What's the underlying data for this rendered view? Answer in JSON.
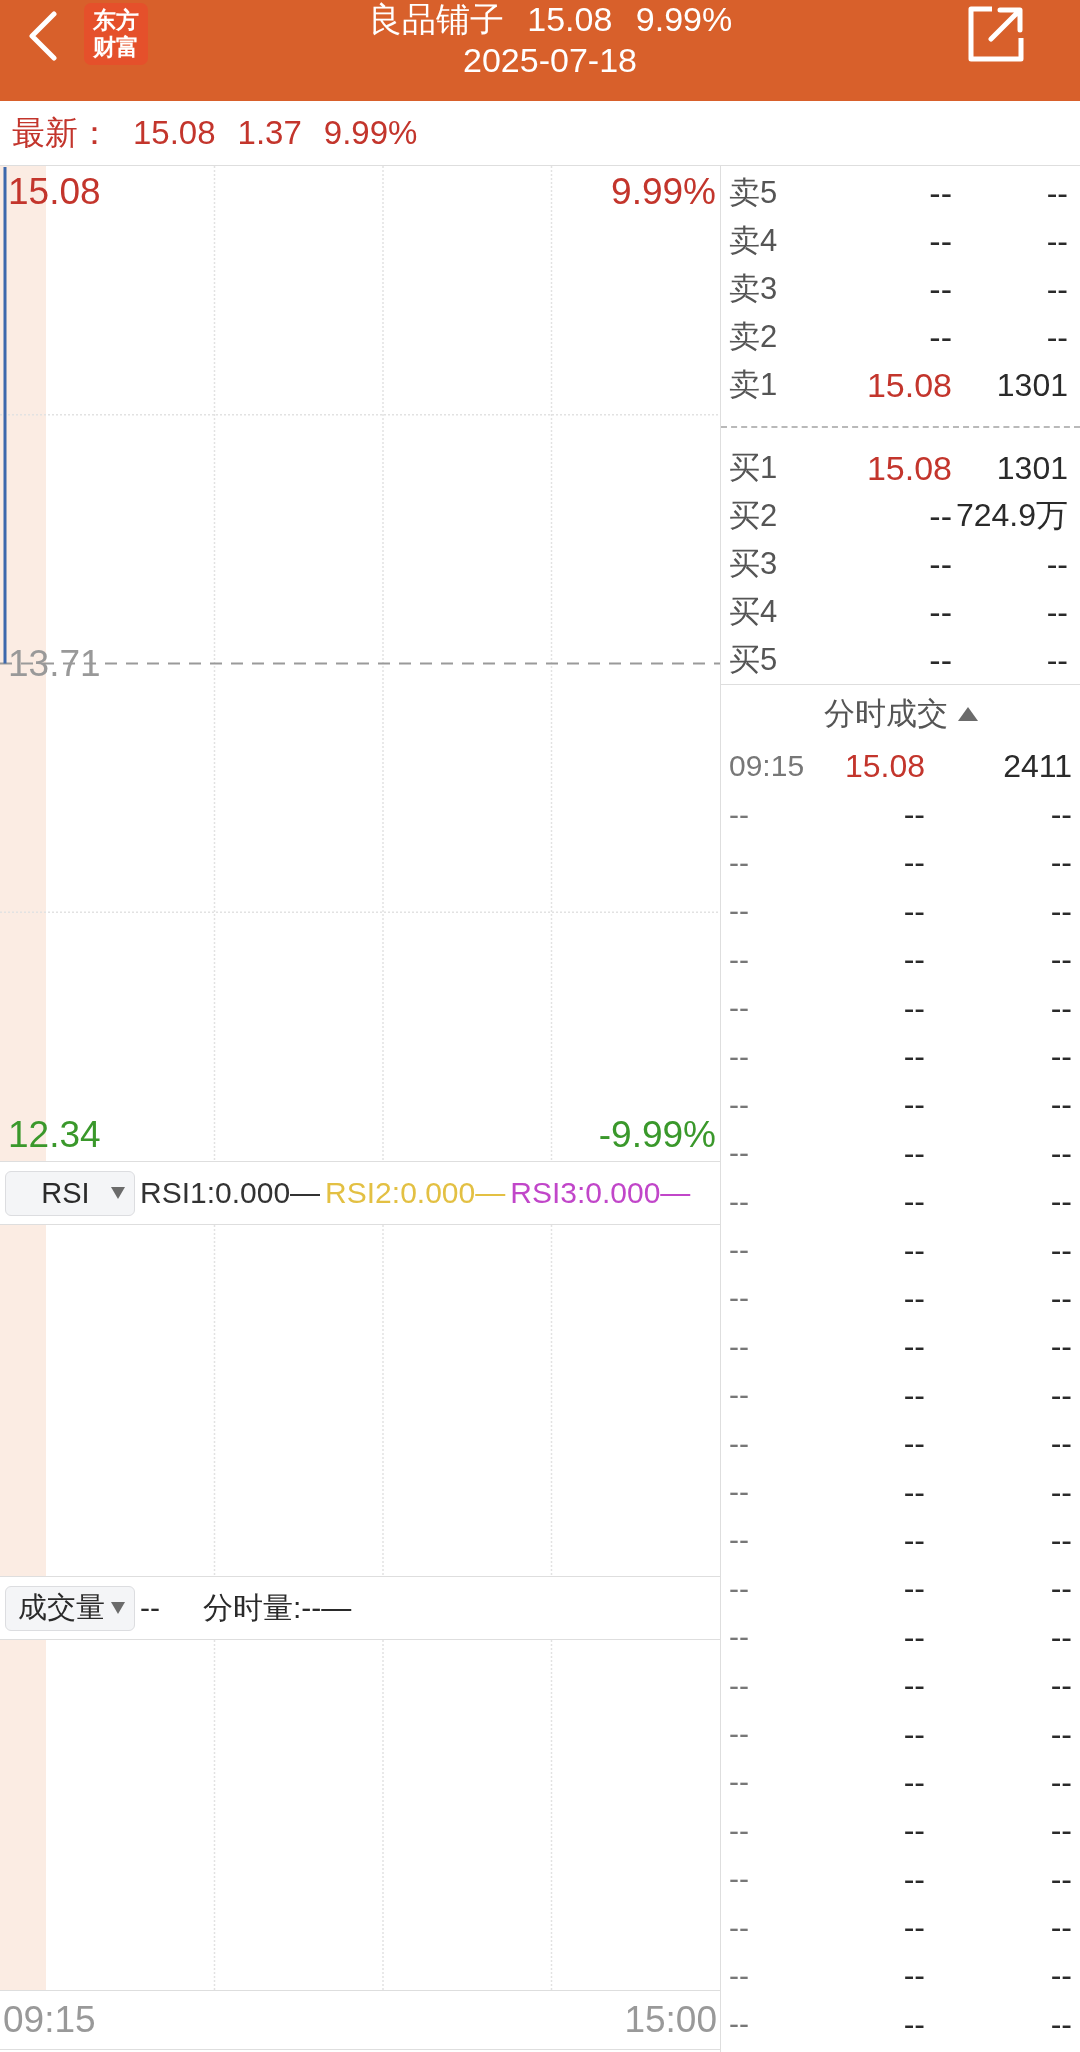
{
  "header": {
    "title": "良品铺子 15.08 9.99%",
    "date": "2025-07-18",
    "logo": [
      "东方",
      "财富"
    ]
  },
  "latest": {
    "label": "最新：",
    "price": "15.08",
    "change": "1.37",
    "pct": "9.99%"
  },
  "price_chart": {
    "left_labels": [
      {
        "text": "15.08",
        "color": "#c3352c"
      },
      {
        "text": "13.71",
        "color": "#999999"
      },
      {
        "text": "12.34",
        "color": "#3a982b"
      }
    ],
    "right_labels": [
      {
        "text": "9.99%",
        "color": "#c3352c"
      },
      {
        "text": "-9.99%",
        "color": "#3a982b"
      }
    ]
  },
  "rsi": {
    "selector": "RSI",
    "legend": [
      {
        "text": "RSI1:0.000—",
        "color": "#333333"
      },
      {
        "text": "RSI2:0.000—",
        "color": "#e3c043"
      },
      {
        "text": "RSI3:0.000—",
        "color": "#c146c9"
      }
    ]
  },
  "volume": {
    "selector": "成交量",
    "value": "--",
    "label": "分时量:--—"
  },
  "time_axis": [
    "09:15",
    "15:00"
  ],
  "order_book": {
    "asks": [
      {
        "label": "卖5",
        "price": "--",
        "volume": "--",
        "color": "#2a2a2a"
      },
      {
        "label": "卖4",
        "price": "--",
        "volume": "--",
        "color": "#2a2a2a"
      },
      {
        "label": "卖3",
        "price": "--",
        "volume": "--",
        "color": "#2a2a2a"
      },
      {
        "label": "卖2",
        "price": "--",
        "volume": "--",
        "color": "#2a2a2a"
      },
      {
        "label": "卖1",
        "price": "15.08",
        "volume": "1301",
        "color": "#c3352c"
      }
    ],
    "bids": [
      {
        "label": "买1",
        "price": "15.08",
        "volume": "1301",
        "color": "#c3352c"
      },
      {
        "label": "买2",
        "price": "--",
        "volume": "724.9万",
        "color": "#2a2a2a"
      },
      {
        "label": "买3",
        "price": "--",
        "volume": "--",
        "color": "#2a2a2a"
      },
      {
        "label": "买4",
        "price": "--",
        "volume": "--",
        "color": "#2a2a2a"
      },
      {
        "label": "买5",
        "price": "--",
        "volume": "--",
        "color": "#2a2a2a"
      }
    ]
  },
  "trades": {
    "title": "分时成交",
    "rows": [
      {
        "time": "09:15",
        "price": "15.08",
        "volume": "2411",
        "color": "#c3352c"
      },
      {
        "time": "--",
        "price": "--",
        "volume": "--",
        "color": "#2a2a2a"
      },
      {
        "time": "--",
        "price": "--",
        "volume": "--",
        "color": "#2a2a2a"
      },
      {
        "time": "--",
        "price": "--",
        "volume": "--",
        "color": "#2a2a2a"
      },
      {
        "time": "--",
        "price": "--",
        "volume": "--",
        "color": "#2a2a2a"
      },
      {
        "time": "--",
        "price": "--",
        "volume": "--",
        "color": "#2a2a2a"
      },
      {
        "time": "--",
        "price": "--",
        "volume": "--",
        "color": "#2a2a2a"
      },
      {
        "time": "--",
        "price": "--",
        "volume": "--",
        "color": "#2a2a2a"
      },
      {
        "time": "--",
        "price": "--",
        "volume": "--",
        "color": "#2a2a2a"
      },
      {
        "time": "--",
        "price": "--",
        "volume": "--",
        "color": "#2a2a2a"
      },
      {
        "time": "--",
        "price": "--",
        "volume": "--",
        "color": "#2a2a2a"
      },
      {
        "time": "--",
        "price": "--",
        "volume": "--",
        "color": "#2a2a2a"
      },
      {
        "time": "--",
        "price": "--",
        "volume": "--",
        "color": "#2a2a2a"
      },
      {
        "time": "--",
        "price": "--",
        "volume": "--",
        "color": "#2a2a2a"
      },
      {
        "time": "--",
        "price": "--",
        "volume": "--",
        "color": "#2a2a2a"
      },
      {
        "time": "--",
        "price": "--",
        "volume": "--",
        "color": "#2a2a2a"
      },
      {
        "time": "--",
        "price": "--",
        "volume": "--",
        "color": "#2a2a2a"
      },
      {
        "time": "--",
        "price": "--",
        "volume": "--",
        "color": "#2a2a2a"
      },
      {
        "time": "--",
        "price": "--",
        "volume": "--",
        "color": "#2a2a2a"
      },
      {
        "time": "--",
        "price": "--",
        "volume": "--",
        "color": "#2a2a2a"
      },
      {
        "time": "--",
        "price": "--",
        "volume": "--",
        "color": "#2a2a2a"
      },
      {
        "time": "--",
        "price": "--",
        "volume": "--",
        "color": "#2a2a2a"
      },
      {
        "time": "--",
        "price": "--",
        "volume": "--",
        "color": "#2a2a2a"
      },
      {
        "time": "--",
        "price": "--",
        "volume": "--",
        "color": "#2a2a2a"
      },
      {
        "time": "--",
        "price": "--",
        "volume": "--",
        "color": "#2a2a2a"
      },
      {
        "time": "--",
        "price": "--",
        "volume": "--",
        "color": "#2a2a2a"
      },
      {
        "time": "--",
        "price": "--",
        "volume": "--",
        "color": "#2a2a2a"
      }
    ]
  }
}
